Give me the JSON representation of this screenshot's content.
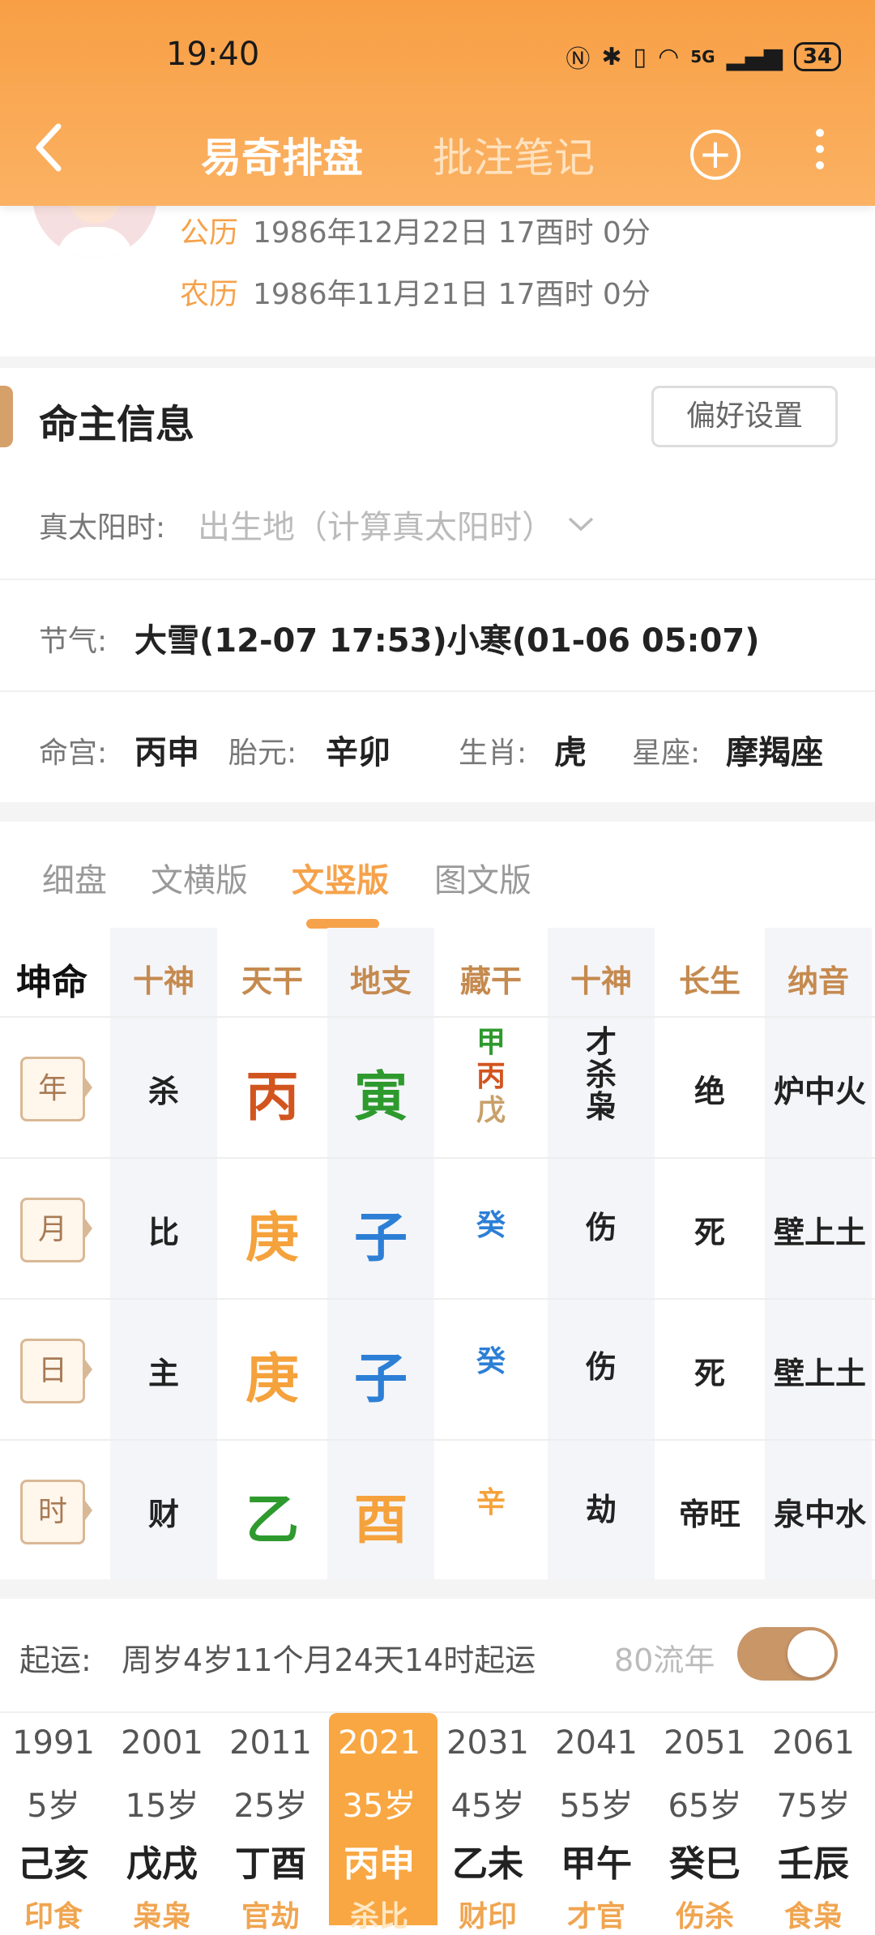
{
  "status": {
    "time": "19:40",
    "battery": "34",
    "network": "5G"
  },
  "nav": {
    "back_icon": "chevron-left-icon",
    "title": "易奇排盘",
    "title2": "批注笔记",
    "plus_icon": "plus-circle-icon",
    "more_icon": "more-vertical-icon"
  },
  "profile": {
    "solar_label": "公历",
    "solar_value": "1986年12月22日 17酉时 0分",
    "lunar_label": "农历",
    "lunar_value": "1986年11月21日 17酉时 0分"
  },
  "info": {
    "section_title": "命主信息",
    "pref_button": "偏好设置",
    "true_solar_label": "真太阳时:",
    "true_solar_placeholder": "出生地（计算真太阳时）",
    "jieqi_label": "节气:",
    "jieqi_value": "大雪(12-07 17:53)小寒(01-06 05:07)",
    "minggong_label": "命宫:",
    "minggong_value": "丙申",
    "taiyuan_label": "胎元:",
    "taiyuan_value": "辛卯",
    "shengxiao_label": "生肖:",
    "shengxiao_value": "虎",
    "xingzuo_label": "星座:",
    "xingzuo_value": "摩羯座"
  },
  "tabs": [
    "细盘",
    "文横版",
    "文竖版",
    "图文版"
  ],
  "active_tab": "文竖版",
  "grid": {
    "corner": "坤命",
    "headers": [
      "十神",
      "天干",
      "地支",
      "藏干",
      "十神",
      "长生",
      "纳音"
    ],
    "rows": [
      {
        "pillar": "年",
        "shishen": "杀",
        "tiangan": "丙",
        "tiangan_color": "#d2541e",
        "dizhi": "寅",
        "dizhi_color": "#2e9a2e",
        "canggan": [
          {
            "t": "甲",
            "c": "#2e9a2e"
          },
          {
            "t": "丙",
            "c": "#d2541e"
          },
          {
            "t": "戊",
            "c": "#c9a06a"
          }
        ],
        "shishen2": "才杀枭",
        "changsheng": "绝",
        "nayin": "炉中火"
      },
      {
        "pillar": "月",
        "shishen": "比",
        "tiangan": "庚",
        "tiangan_color": "#f5a23c",
        "dizhi": "子",
        "dizhi_color": "#2d7fd6",
        "canggan": [
          {
            "t": "癸",
            "c": "#2d7fd6"
          }
        ],
        "shishen2": "伤",
        "changsheng": "死",
        "nayin": "壁上土"
      },
      {
        "pillar": "日",
        "shishen": "主",
        "tiangan": "庚",
        "tiangan_color": "#f5a23c",
        "dizhi": "子",
        "dizhi_color": "#2d7fd6",
        "canggan": [
          {
            "t": "癸",
            "c": "#2d7fd6"
          }
        ],
        "shishen2": "伤",
        "changsheng": "死",
        "nayin": "壁上土"
      },
      {
        "pillar": "时",
        "shishen": "财",
        "tiangan": "乙",
        "tiangan_color": "#2e9a2e",
        "dizhi": "酉",
        "dizhi_color": "#f5a23c",
        "canggan": [
          {
            "t": "辛",
            "c": "#f5a23c"
          }
        ],
        "shishen2": "劫",
        "changsheng": "帝旺",
        "nayin": "泉中水"
      }
    ]
  },
  "luck": {
    "start_label": "起运:",
    "start_value": "周岁4岁11个月24天14时起运",
    "liunian_label": "80流年",
    "toggle_on": true,
    "columns": [
      {
        "year": "1991",
        "age": "5岁",
        "ganzhi": "己亥",
        "shishen": "印食"
      },
      {
        "year": "2001",
        "age": "15岁",
        "ganzhi": "戊戌",
        "shishen": "枭枭"
      },
      {
        "year": "2011",
        "age": "25岁",
        "ganzhi": "丁酉",
        "shishen": "官劫"
      },
      {
        "year": "2021",
        "age": "35岁",
        "ganzhi": "丙申",
        "shishen": "杀比"
      },
      {
        "year": "2031",
        "age": "45岁",
        "ganzhi": "乙未",
        "shishen": "财印"
      },
      {
        "year": "2041",
        "age": "55岁",
        "ganzhi": "甲午",
        "shishen": "才官"
      },
      {
        "year": "2051",
        "age": "65岁",
        "ganzhi": "癸巳",
        "shishen": "伤杀"
      },
      {
        "year": "2061",
        "age": "75岁",
        "ganzhi": "壬辰",
        "shishen": "食枭"
      }
    ],
    "active_year": "2021"
  },
  "colors": {
    "accent": "#f9a742",
    "header_gradient_top": "#f89f45",
    "label_gold": "#c58a4f",
    "toggle": "#c99668"
  }
}
